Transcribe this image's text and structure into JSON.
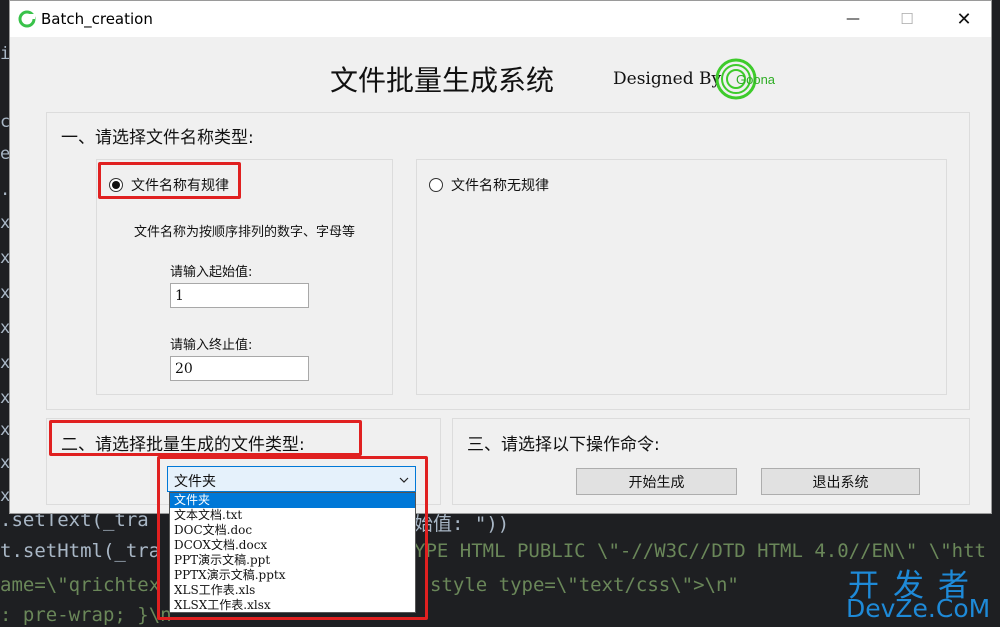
{
  "window": {
    "title": "Batch_creation",
    "minimize": "—",
    "maximize": "☐",
    "close": "✕"
  },
  "header": {
    "title": "文件批量生成系统",
    "designed_by": "Designed By",
    "logo_text": "Goona"
  },
  "section1": {
    "title": "一、请选择文件名称类型:",
    "radio_regular": "文件名称有规律",
    "radio_irregular": "文件名称无规律",
    "description": "文件名称为按顺序排列的数字、字母等",
    "start_label": "请输入起始值:",
    "start_value": "1",
    "end_label": "请输入终止值:",
    "end_value": "20"
  },
  "section2": {
    "title": "二、请选择批量生成的文件类型:",
    "combo_value": "文件夹",
    "options": [
      "文件夹",
      "文本文档.txt",
      "DOC文档.doc",
      "DCOX文档.docx",
      "PPT演示文稿.ppt",
      "PPTX演示文稿.pptx",
      "XLS工作表.xls",
      "XLSX工作表.xlsx"
    ]
  },
  "section3": {
    "title": "三、请选择以下操作命令:",
    "start_button": "开始生成",
    "exit_button": "退出系统"
  },
  "background_code": {
    "line1a": ".setText(_tra",
    "line1b": "始值: \"))",
    "line2a": "t.setHtml(_tra",
    "line2b": "YPE HTML PUBLIC \\\"-//W3C//DTD HTML 4.0//EN\\\" \\\"htt",
    "line3a": "ame=\\\"qrichtex",
    "line3b": "style type=\\\"text/css\\\">\\n\"",
    "line4a": ": pre-wrap; }\\n\"",
    "gutter": [
      "i",
      "c",
      "e",
      ".",
      "x",
      "x",
      "x",
      "x",
      "x",
      "x",
      "x",
      "x",
      "x",
      "x",
      "x"
    ]
  },
  "watermark": {
    "line1": "开发者",
    "line2": "DevZe.CoM"
  }
}
